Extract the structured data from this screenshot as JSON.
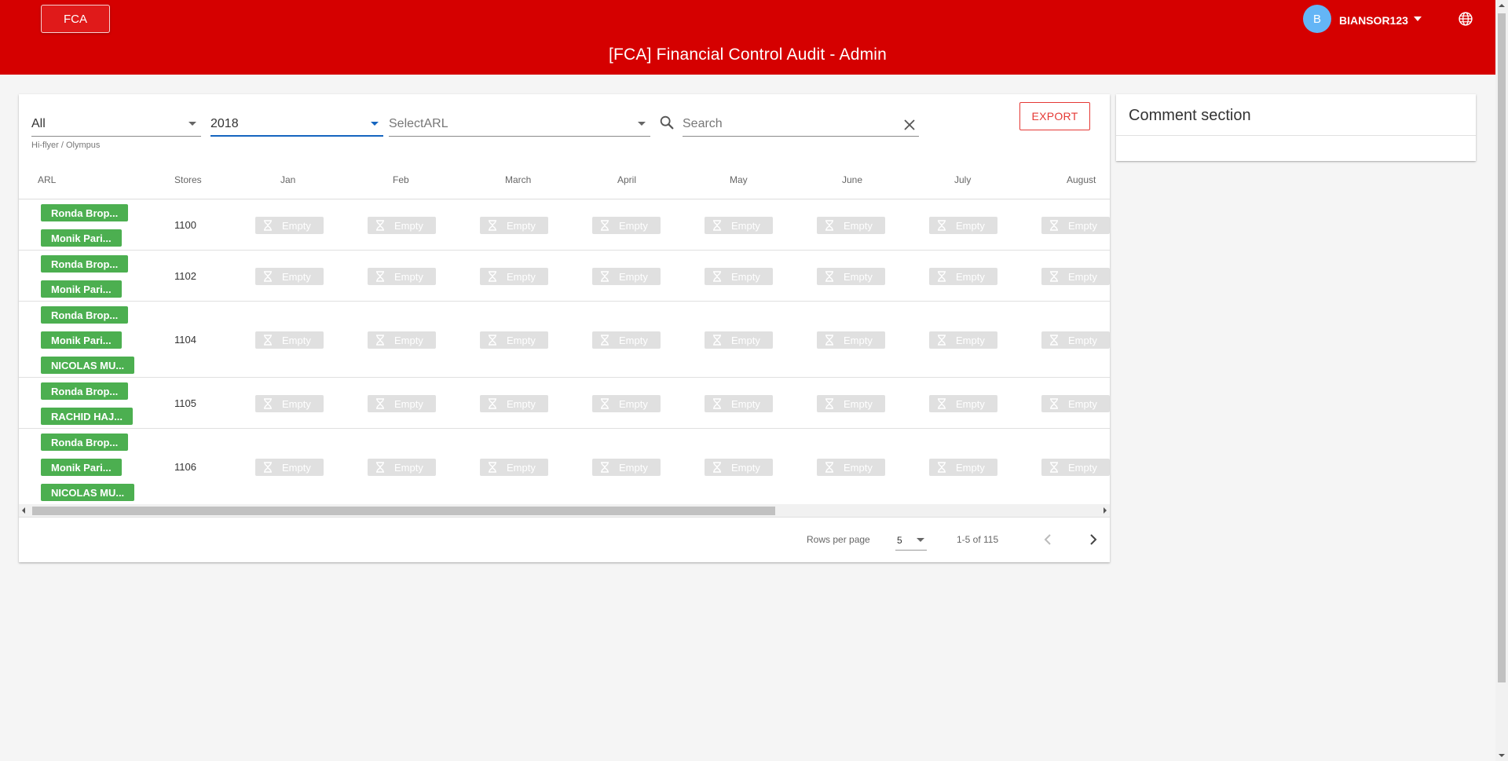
{
  "header": {
    "app_button": "FCA",
    "title": "[FCA] Financial Control Audit - Admin",
    "avatar_letter": "B",
    "user_name": "BIANSOR123",
    "language_icon": "globe-icon"
  },
  "filters": {
    "group_value": "All",
    "group_helper": "Hi-flyer / Olympus",
    "year_value": "2018",
    "arl_placeholder": "SelectARL",
    "search_placeholder": "Search",
    "export_label": "EXPORT"
  },
  "table": {
    "columns": [
      "ARL",
      "Stores",
      "Jan",
      "Feb",
      "March",
      "April",
      "May",
      "June",
      "July",
      "August"
    ],
    "empty_label": "Empty",
    "rows": [
      {
        "arl": [
          "Ronda Brop...",
          "Monik Pari..."
        ],
        "store": "1100"
      },
      {
        "arl": [
          "Ronda Brop...",
          "Monik Pari..."
        ],
        "store": "1102"
      },
      {
        "arl": [
          "Ronda Brop...",
          "Monik Pari...",
          "NICOLAS MU..."
        ],
        "store": "1104"
      },
      {
        "arl": [
          "Ronda Brop...",
          "RACHID HAJ..."
        ],
        "store": "1105"
      },
      {
        "arl": [
          "Ronda Brop...",
          "Monik Pari...",
          "NICOLAS MU..."
        ],
        "store": "1106"
      }
    ]
  },
  "pagination": {
    "rows_per_page_label": "Rows per page",
    "rows_per_page_value": "5",
    "range": "1-5 of 115"
  },
  "comments": {
    "title": "Comment section"
  },
  "colors": {
    "header_bg": "#d50000",
    "chip_green": "#4caf50",
    "export_red": "#e53935",
    "active_blue": "#1565c0",
    "empty_cell": "#e0e0e0"
  }
}
